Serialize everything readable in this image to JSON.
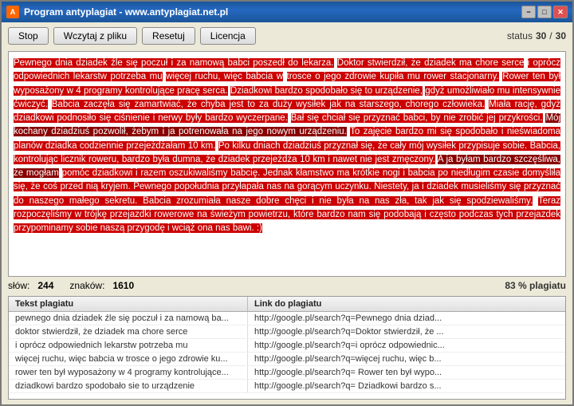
{
  "window": {
    "title": "Program antyplagiat - www.antyplagiat.net.pl",
    "icon": "A"
  },
  "titleButtons": {
    "minimize": "−",
    "maximize": "□",
    "close": "✕"
  },
  "toolbar": {
    "stopBtn": "Stop",
    "loadBtn": "Wczytaj z pliku",
    "resetBtn": "Resetuj",
    "licenseBtn": "Licencja",
    "statusLabel": "status",
    "statusCurrent": "30",
    "statusTotal": "30"
  },
  "textContent": "Pewnego dnia dziadek źle się poczuł i za namową babci poszedł do lekarza. Doktor stwierdził, że dziadek ma chore serce i oprócz odpowiednich lekarstw potrzeba mu więcej ruchu, więc babcia w trosce o jego zdrowie kupiła mu rower stacjonarny. Rower ten był wyposażony w 4 programy kontrolujące pracę serca. Dziadkowi bardzo spodobało się to urządzenie, gdyż umożliwiało mu intensywnie ćwiczyć. Babcia zaczęła się zamartwiać, że chyba jest to za duży wysiłek jak na starszego, chorego człowieka. Miała rację, gdyż dziadkowi podnosiło się ciśnienie i nerwy były bardzo wyczerpane. Bał się chciał się przyznać babci, by nie zrobić jej przykrości. Mój kochany dziadziuś pozwolił, żebym i ja potrenowała na jego nowym urządzeniu. To zajęcie bardzo mi się spodobało i nieświadoma planów dziadka codziennie przejeżdżałam 10 km. Po kilku dniach dziadziuś przyznał się, że cały mój wysiłek przypisuje sobie. Babcia, kontrolując licznik roweru, bardzo była dumna, że dziadek przejeżdża 10 km i nawet nie jest zmęczony. A ja byłam bardzo szczęśliwa, że mogłam pomóc dziadkowi i razem oszukiwaliśmy babcię. Jednak kłamstwo ma krótkie nogi i babcia po niedługim czasie domyśliła się, że coś przed nią kryjem. Pewnego popołudnia przyłapała nas na gorącym uczynku. Niestety, ja i dziadek musieliśmy się przyznać do naszego małego sekretu. Babcia zrozumiała nasze dobre chęci i nie była na nas zła, tak jak się spodziewaliśmy. Teraz rozpoczęliśmy w trójkę przejazdki rowerowe na świeżym powietrzu, które bardzo nam się podobają i często podczas tych przejazdek przypominamy sobie naszą przygodę i wciąż ona nas bawi. :)",
  "stats": {
    "wordsLabel": "słów:",
    "wordsValue": "244",
    "charsLabel": "znaków:",
    "charsValue": "1610",
    "plagiatLabel": "83 % plagiatu"
  },
  "table": {
    "headers": [
      "Tekst plagiatu",
      "Link do plagiatu"
    ],
    "rows": [
      {
        "text": "pewnego dnia dziadek źle się poczuł i za namową ba...",
        "link": "http://google.pl/search?q=Pewnego dnia dziad..."
      },
      {
        "text": "doktor stwierdził, że dziadek ma chore serce",
        "link": "http://google.pl/search?q=Doktor stwierdził, że ..."
      },
      {
        "text": "i oprócz odpowiednich lekarstw potrzeba mu",
        "link": "http://google.pl/search?q=i oprócz odpowiednic..."
      },
      {
        "text": "więcej ruchu, więc babcia w trosce o jego zdrowie ku...",
        "link": "http://google.pl/search?q=więcej ruchu, więc b..."
      },
      {
        "text": "rower ten był wyposażony w 4 programy kontrolujące...",
        "link": "http://google.pl/search?q= Rower ten był wypo..."
      },
      {
        "text": "dziadkowi bardzo spodobało sie to urządzenie",
        "link": "http://google.pl/search?q= Dziadkowi bardzo s..."
      }
    ]
  }
}
